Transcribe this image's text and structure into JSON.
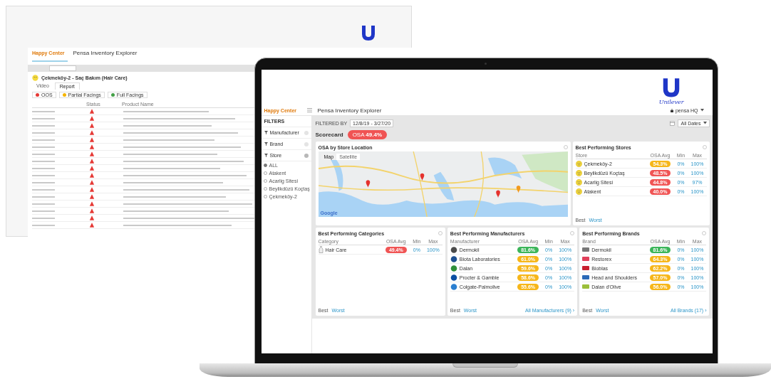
{
  "backdrop_window": {
    "brand": "Happy Center",
    "title": "Pensa Inventory Explorer",
    "store_title": "Çekmeköy-2 - Saç Bakım (Hair Care)",
    "tabs": [
      {
        "label": "Video",
        "selected": false
      },
      {
        "label": "Report",
        "selected": true
      }
    ],
    "status_filters": [
      {
        "label": "OOS",
        "color": "#e53935"
      },
      {
        "label": "Partial Facings",
        "color": "#f5b400"
      },
      {
        "label": "Full Facings",
        "color": "#43a047"
      }
    ],
    "columns": [
      "Status",
      "Product Name"
    ],
    "rows": [
      {
        "color": "#e53935"
      },
      {
        "color": "#e53935"
      },
      {
        "color": "#e53935"
      },
      {
        "color": "#e53935"
      },
      {
        "color": "#e53935"
      },
      {
        "color": "#e53935"
      },
      {
        "color": "#e53935"
      },
      {
        "color": "#e53935"
      },
      {
        "color": "#e53935"
      },
      {
        "color": "#e53935"
      },
      {
        "color": "#e53935"
      },
      {
        "color": "#e53935"
      },
      {
        "color": "#e53935"
      },
      {
        "color": "#e53935"
      },
      {
        "color": "#e53935"
      },
      {
        "color": "#e53935"
      },
      {
        "color": "#e53935"
      }
    ]
  },
  "logo": {
    "wordmark": "Unilever"
  },
  "app": {
    "brand": "Happy Center",
    "title": "Pensa Inventory Explorer",
    "user": "pensa HQ"
  },
  "sidebar": {
    "heading": "FILTERS",
    "groups": [
      {
        "label": "Manufacturer",
        "expanded": false
      },
      {
        "label": "Brand",
        "expanded": false
      },
      {
        "label": "Store",
        "expanded": true,
        "options": [
          {
            "label": "ALL",
            "selected": true
          },
          {
            "label": "Atakent",
            "selected": false
          },
          {
            "label": "Acarlig Sitesi",
            "selected": false
          },
          {
            "label": "Beylikdüzü Koçtaş",
            "selected": false
          },
          {
            "label": "Çekmeköy-2",
            "selected": false
          }
        ]
      }
    ]
  },
  "filter_bar": {
    "label": "FILTERED BY",
    "date_range": "12/8/19 - 3/27/20",
    "date_select": "All Dates"
  },
  "scorecard": {
    "label": "Scorecard",
    "metric": "OSA",
    "value": "49.4%",
    "color": "#f05454"
  },
  "map_card": {
    "title": "OSA by Store Location",
    "tabs": [
      {
        "label": "Map",
        "selected": true
      },
      {
        "label": "Satellite",
        "selected": false
      }
    ],
    "attribution": "Google"
  },
  "tables": [
    {
      "kind": "store",
      "title": "Best Performing Stores",
      "columns": [
        "Store",
        "OSA Avg",
        "Min",
        "Max"
      ],
      "rows": [
        {
          "name": "Çekmeköy-2",
          "osa": "54.3%",
          "color": "#f6b619",
          "min": "0%",
          "max": "100%"
        },
        {
          "name": "Beylikdüzü Koçtaş",
          "osa": "48.5%",
          "color": "#f05454",
          "min": "0%",
          "max": "100%"
        },
        {
          "name": "Acarlig Sitesi",
          "osa": "44.8%",
          "color": "#f05454",
          "min": "0%",
          "max": "97%"
        },
        {
          "name": "Atakent",
          "osa": "40.0%",
          "color": "#f05454",
          "min": "0%",
          "max": "100%"
        }
      ],
      "footer": {
        "best": "Best",
        "worst": "Worst"
      }
    },
    {
      "kind": "category",
      "title": "Best Performing Categories",
      "columns": [
        "Category",
        "OSA Avg",
        "Min",
        "Max"
      ],
      "rows": [
        {
          "name": "Hair Care",
          "osa": "49.4%",
          "color": "#f05454",
          "min": "0%",
          "max": "100%"
        }
      ],
      "footer": {
        "best": "Best",
        "worst": "Worst"
      }
    },
    {
      "kind": "manufacturer",
      "title": "Best Performing Manufacturers",
      "columns": [
        "Manufacturer",
        "OSA Avg",
        "Min",
        "Max"
      ],
      "rows": [
        {
          "name": "Dermokil",
          "osa": "81.6%",
          "color": "#3cb55a",
          "min": "0%",
          "max": "100%"
        },
        {
          "name": "Biota Laboratories",
          "osa": "61.0%",
          "color": "#f6b619",
          "min": "0%",
          "max": "100%"
        },
        {
          "name": "Dalan",
          "osa": "59.6%",
          "color": "#f6b619",
          "min": "0%",
          "max": "100%"
        },
        {
          "name": "Procter & Gamble",
          "osa": "58.6%",
          "color": "#f6b619",
          "min": "0%",
          "max": "100%"
        },
        {
          "name": "Colgate-Palmolive",
          "osa": "55.6%",
          "color": "#f6b619",
          "min": "0%",
          "max": "100%"
        }
      ],
      "footer": {
        "best": "Best",
        "worst": "Worst",
        "link": "All Manufacturers (9) ›"
      }
    },
    {
      "kind": "brand",
      "title": "Best Performing Brands",
      "columns": [
        "Brand",
        "OSA Avg",
        "Min",
        "Max"
      ],
      "rows": [
        {
          "name": "Dermokil",
          "osa": "81.6%",
          "color": "#3cb55a",
          "min": "0%",
          "max": "100%"
        },
        {
          "name": "Restorex",
          "osa": "64.3%",
          "color": "#f6b619",
          "min": "0%",
          "max": "100%"
        },
        {
          "name": "Bioblas",
          "osa": "62.2%",
          "color": "#f6b619",
          "min": "0%",
          "max": "100%"
        },
        {
          "name": "Head and Shoulders",
          "osa": "57.0%",
          "color": "#f6b619",
          "min": "0%",
          "max": "100%"
        },
        {
          "name": "Dalan d'Olive",
          "osa": "56.0%",
          "color": "#f6b619",
          "min": "0%",
          "max": "100%"
        }
      ],
      "footer": {
        "best": "Best",
        "worst": "Worst",
        "link": "All Brands (17) ›"
      }
    }
  ]
}
